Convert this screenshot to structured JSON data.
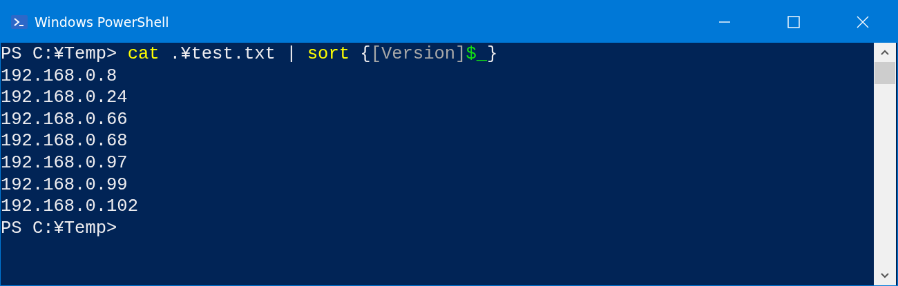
{
  "window": {
    "title": "Windows PowerShell"
  },
  "console": {
    "lines": [
      {
        "segments": [
          {
            "kind": "prompt",
            "text": "PS C:¥Temp> "
          },
          {
            "kind": "command",
            "text": "cat"
          },
          {
            "kind": "plain",
            "text": " .¥test.txt | "
          },
          {
            "kind": "command",
            "text": "sort"
          },
          {
            "kind": "plain",
            "text": " {"
          },
          {
            "kind": "type",
            "text": "[Version]"
          },
          {
            "kind": "variable",
            "text": "$_"
          },
          {
            "kind": "plain",
            "text": "}"
          }
        ]
      },
      {
        "segments": [
          {
            "kind": "output",
            "text": "192.168.0.8"
          }
        ]
      },
      {
        "segments": [
          {
            "kind": "output",
            "text": "192.168.0.24"
          }
        ]
      },
      {
        "segments": [
          {
            "kind": "output",
            "text": "192.168.0.66"
          }
        ]
      },
      {
        "segments": [
          {
            "kind": "output",
            "text": "192.168.0.68"
          }
        ]
      },
      {
        "segments": [
          {
            "kind": "output",
            "text": "192.168.0.97"
          }
        ]
      },
      {
        "segments": [
          {
            "kind": "output",
            "text": "192.168.0.99"
          }
        ]
      },
      {
        "segments": [
          {
            "kind": "output",
            "text": "192.168.0.102"
          }
        ]
      },
      {
        "segments": [
          {
            "kind": "prompt",
            "text": "PS C:¥Temp>"
          }
        ]
      }
    ]
  }
}
